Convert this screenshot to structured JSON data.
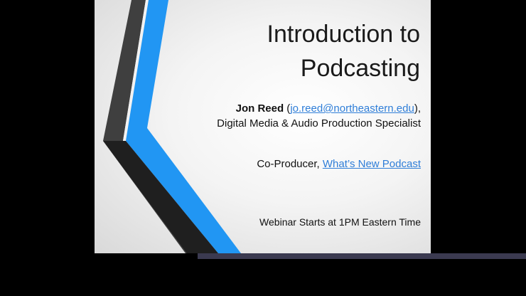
{
  "slide": {
    "title": "Introduction to\nPodcasting",
    "presenter": {
      "name": "Jon Reed",
      "open_paren": " (",
      "email": "jo.reed@northeastern.edu",
      "close": "),",
      "role": "Digital Media & Audio Production Specialist"
    },
    "coproducer": {
      "label": "Co-Producer, ",
      "podcast_link": "What’s New Podcast"
    },
    "webinar_note": "Webinar Starts at 1PM Eastern Time"
  },
  "colors": {
    "accent_blue": "#2196f3",
    "chevron_dark": "#404040",
    "chevron_black": "#1c1c1c",
    "link": "#2f7ed8",
    "progress_bar": "#3b3a50"
  }
}
